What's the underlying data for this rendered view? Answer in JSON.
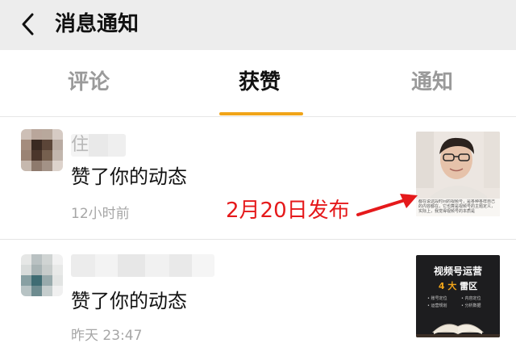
{
  "header": {
    "title": "消息通知",
    "back_icon": "chevron-left-icon"
  },
  "tabs": [
    {
      "label": "评论",
      "active": false
    },
    {
      "label": "获赞",
      "active": true
    },
    {
      "label": "通知",
      "active": false
    }
  ],
  "colors": {
    "accent": "#f0a419",
    "annotation": "#e5191b",
    "header_bg": "#ededed",
    "muted_text": "#a6a6a6"
  },
  "notifications": [
    {
      "name_partial": "住",
      "action": "赞了你的动态",
      "time": "12小时前",
      "thumbnail": {
        "caption": "都在说这段时间的视频号，是各种各样自己的内容都在，它也算是视频号的主题定义，实际上，我觉得视频号的本质是"
      }
    },
    {
      "action": "赞了你的动态",
      "time": "昨天 23:47",
      "thumbnail": {
        "title": "视频号运营",
        "subtitle_num": "4",
        "subtitle_a": "大",
        "subtitle_b": "雷区",
        "bullets": [
          "• 账号定位",
          "• 内容定位",
          "• 运营规划",
          "• 分析数据"
        ]
      }
    }
  ],
  "annotation": {
    "text": "2月20日发布"
  }
}
